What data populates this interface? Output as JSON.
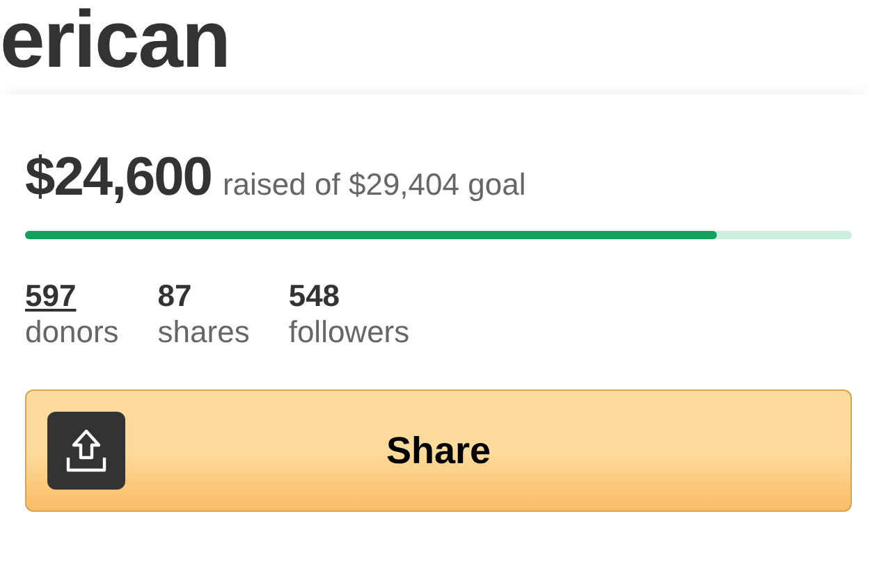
{
  "title": "erican",
  "raised": {
    "amount": "$24,600",
    "caption": "raised of $29,404 goal",
    "level": 0.837
  },
  "stats": [
    {
      "value": "597",
      "label": "donors",
      "link": true
    },
    {
      "value": "87",
      "label": "shares",
      "link": false
    },
    {
      "value": "548",
      "label": "followers",
      "link": false
    }
  ],
  "share_button": {
    "label": "Share"
  }
}
